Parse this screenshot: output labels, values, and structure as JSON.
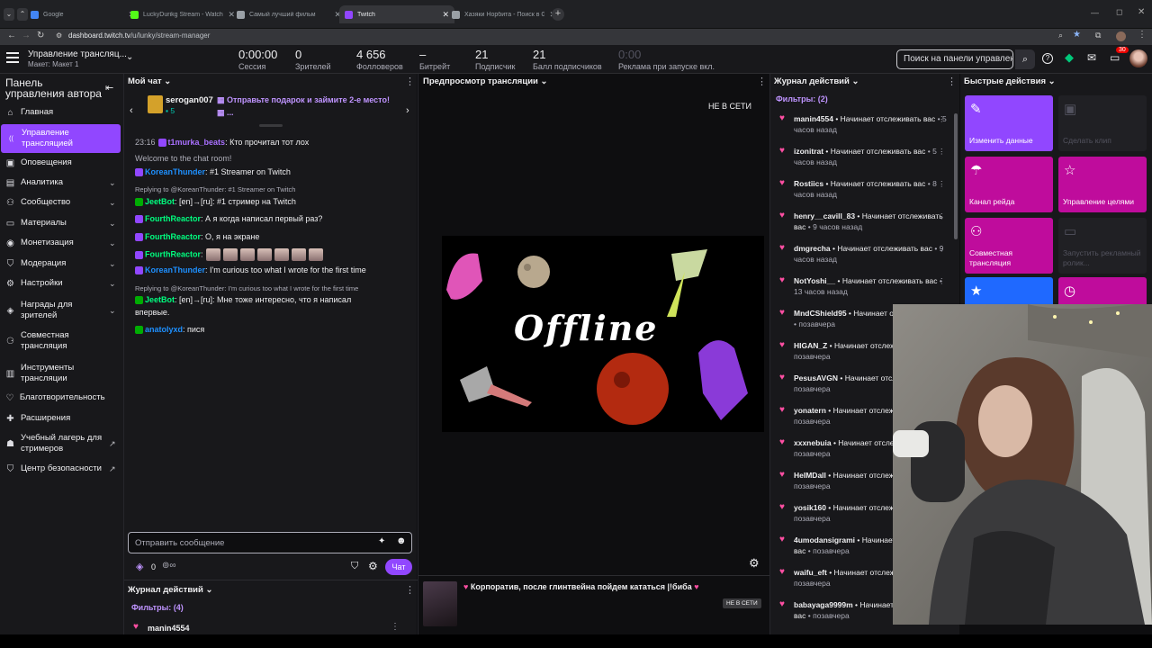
{
  "browser": {
    "tabs": [
      {
        "label": "Google",
        "color": "#4285f4"
      },
      {
        "label": "LuckyDurikg Stream - Watch Li...",
        "color": "#53fc18"
      },
      {
        "label": "Самый лучший фильм",
        "color": "#9aa0a6"
      },
      {
        "label": "Twitch",
        "color": "#9146ff"
      },
      {
        "label": "Хазяки Норбита - Поиск в Goog...",
        "color": "#9aa0a6"
      }
    ],
    "url_host": "dashboard.twitch.tv",
    "url_path": "/u/lunky/stream-manager"
  },
  "header": {
    "title": "Управление трансляц...",
    "subtitle": "Макет: Макет 1",
    "stats": [
      {
        "value": "0:00:00",
        "label": "Сессия"
      },
      {
        "value": "0",
        "label": "Зрителей"
      },
      {
        "value": "4 656",
        "label": "Фолловеров"
      },
      {
        "value": "–",
        "label": "Битрейт"
      },
      {
        "value": "21",
        "label": "Подписчик"
      },
      {
        "value": "21",
        "label": "Балл подписчиков"
      },
      {
        "value": "0:00",
        "label": "Реклама при запуске вкл."
      }
    ],
    "search_placeholder": "Поиск на панели управлен",
    "notif_count": "30"
  },
  "sidebar": {
    "title": "Панель управления автора",
    "items": [
      {
        "label": "Главная",
        "icon": "home-icon",
        "chev": ""
      },
      {
        "label": "Управление трансляцией",
        "icon": "broadcast-icon",
        "chev": ""
      },
      {
        "label": "Оповещения",
        "icon": "bell-icon",
        "chev": ""
      },
      {
        "label": "Аналитика",
        "icon": "chart-icon",
        "chev": "⌄"
      },
      {
        "label": "Сообщество",
        "icon": "community-icon",
        "chev": "⌄"
      },
      {
        "label": "Материалы",
        "icon": "folder-icon",
        "chev": "⌄"
      },
      {
        "label": "Монетизация",
        "icon": "money-icon",
        "chev": "⌄"
      },
      {
        "label": "Модерация",
        "icon": "shield-icon",
        "chev": "⌄"
      },
      {
        "label": "Настройки",
        "icon": "gear-icon",
        "chev": "⌄"
      },
      {
        "label": "Награды для зрителей",
        "icon": "reward-icon",
        "chev": "⌄"
      },
      {
        "label": "Совместная трансляция",
        "icon": "collab-icon",
        "chev": ""
      },
      {
        "label": "Инструменты трансляции",
        "icon": "tools-icon",
        "chev": ""
      },
      {
        "label": "Благотворительность",
        "icon": "heart-icon",
        "chev": ""
      },
      {
        "label": "Расширения",
        "icon": "puzzle-icon",
        "chev": ""
      },
      {
        "label": "Учебный лагерь для стримеров",
        "icon": "school-icon",
        "chev": "↗"
      },
      {
        "label": "Центр безопасности",
        "icon": "safety-icon",
        "chev": "↗"
      }
    ]
  },
  "chat": {
    "title": "Мой чат",
    "gift_user": "serogan007",
    "gift_count": "5",
    "gift_text": "Отправьте подарок и займите 2-е место!",
    "gift_more": "...",
    "messages": [
      {
        "time": "23:16",
        "user": "t1murka_beats",
        "color": "#a970ff",
        "text": ": Кто прочитал тот лох"
      },
      {
        "time": "",
        "user": "",
        "color": "#adadb8",
        "text": "Welcome to the chat room!"
      },
      {
        "time": "",
        "user": "KoreanThunder",
        "color": "#1e90ff",
        "text": ": #1 Streamer on Twitch"
      },
      {
        "time": "",
        "user": "",
        "color": "#adadb8",
        "text": "Replying to @KoreanThunder: #1 Streamer on Twitch"
      },
      {
        "time": "",
        "user": "JeetBot",
        "color": "#00ff7f",
        "text": ": [en]→[ru]: #1 стример на Twitch"
      },
      {
        "time": "",
        "user": "FourthReactor",
        "color": "#00ff7f",
        "text": ": А я когда написал первый раз?"
      },
      {
        "time": "",
        "user": "FourthReactor",
        "color": "#00ff7f",
        "text": ": О, я на экране"
      },
      {
        "time": "",
        "user": "FourthReactor",
        "color": "#00ff7f",
        "text": ":"
      },
      {
        "time": "",
        "user": "KoreanThunder",
        "color": "#1e90ff",
        "text": ": I'm curious too what I wrote for the first time"
      },
      {
        "time": "",
        "user": "",
        "color": "#adadb8",
        "text": "Replying to @KoreanThunder: I'm curious too what I wrote for the first time"
      },
      {
        "time": "",
        "user": "JeetBot",
        "color": "#00ff7f",
        "text": ": [en]→[ru]: Мне тоже интересно, что я написал"
      },
      {
        "time": "",
        "user": "",
        "color": "#efeff1",
        "text": "впервые."
      },
      {
        "time": "",
        "user": "anatolyxd",
        "color": "#1e90ff",
        "text": ": пися"
      }
    ],
    "input_placeholder": "Отправить сообщение",
    "points": "0",
    "chat_button": "Чат"
  },
  "bottom_log": {
    "title": "Журнал действий",
    "filters": "Фильтры: (4)",
    "first_user": "manin4554"
  },
  "preview": {
    "title": "Предпросмотр трансляции",
    "offline_badge": "НЕ В СЕТИ",
    "offline_text": "Offline",
    "stream_title": "Корпоратив, после глинтвейна пойдем кататься |!биба",
    "stream_badge": "НЕ В СЕТИ"
  },
  "activity": {
    "title": "Журнал действий",
    "filters": "Фильтры: (2)",
    "entries": [
      {
        "user": "manin4554",
        "action": "Начинает отслеживать вас",
        "time": "5 часов назад"
      },
      {
        "user": "izonitrat",
        "action": "Начинает отслеживать вас",
        "time": "5 часов назад"
      },
      {
        "user": "Rostiics",
        "action": "Начинает отслеживать вас",
        "time": "8 часов назад"
      },
      {
        "user": "henry__cavill_83",
        "action": "Начинает отслеживать вас",
        "time": "9 часов назад"
      },
      {
        "user": "dmgrecha",
        "action": "Начинает отслеживать вас",
        "time": "9 часов назад"
      },
      {
        "user": "NotYoshi__",
        "action": "Начинает отслеживать вас",
        "time": "13 часов назад"
      },
      {
        "user": "MndCShield95",
        "action": "Начинает отслеживать вас",
        "time": "позавчера"
      },
      {
        "user": "HIGAN_Z",
        "action": "Начинает отслеживать вас",
        "time": "позавчера"
      },
      {
        "user": "PesusAVGN",
        "action": "Начинает отслеживать вас",
        "time": "позавчера"
      },
      {
        "user": "yonatern",
        "action": "Начинает отслеживать вас",
        "time": "позавчера"
      },
      {
        "user": "xxxnebuia",
        "action": "Начинает отслеживать вас",
        "time": "позавчера"
      },
      {
        "user": "HeIMDall",
        "action": "Начинает отслеживать вас",
        "time": "позавчера"
      },
      {
        "user": "yosik160",
        "action": "Начинает отслеживать вас",
        "time": "позавчера"
      },
      {
        "user": "4umodansigrami",
        "action": "Начинает отслеживать вас",
        "time": "позавчера"
      },
      {
        "user": "waifu_eft",
        "action": "Начинает отслеживать вас",
        "time": "позавчера"
      },
      {
        "user": "babayaga9999m",
        "action": "Начинает отслеживать вас",
        "time": "позавчера"
      }
    ]
  },
  "quick_actions": {
    "title": "Быстрые действия",
    "items": [
      {
        "label": "Изменить данные",
        "color": "#9147ff",
        "icon": "✎"
      },
      {
        "label": "Сделать клип",
        "color": "#202024",
        "icon": "▣"
      },
      {
        "label": "Канал рейда",
        "color": "#bf0c9c",
        "icon": "☂"
      },
      {
        "label": "Управление целями",
        "color": "#bf0c9c",
        "icon": "☆"
      },
      {
        "label": "Совместная трансляция",
        "color": "#bf0c9c",
        "icon": "⚇"
      },
      {
        "label": "Запустить рекламный ролик...",
        "color": "#202024",
        "icon": "▭"
      },
      {
        "label": "",
        "color": "#1f69ff",
        "icon": "★"
      },
      {
        "label": "",
        "color": "#bf0c9c",
        "icon": "◷"
      }
    ]
  }
}
